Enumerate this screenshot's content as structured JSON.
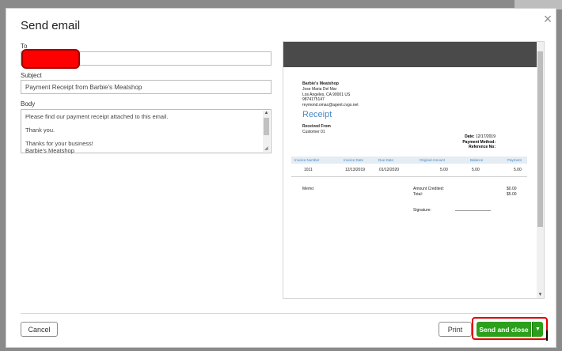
{
  "dialog": {
    "title": "Send email",
    "close_glyph": "×"
  },
  "form": {
    "to_label": "To",
    "to_value": "",
    "subject_label": "Subject",
    "subject_value": "Payment Receipt from Barbie's Meatshop",
    "body_label": "Body",
    "body_lines": [
      "Please find our payment receipt attached to this email.",
      "Thank you.",
      "Thanks for your business!",
      "Barbie's Meatshop"
    ]
  },
  "preview": {
    "business_name": "Barbie's Meatshop",
    "address_lines": [
      "Jose Maria Del Mar",
      "Los Angeles, CA  90001 US",
      "9874175147",
      "reymond.omac@agent.cvgs.net"
    ],
    "doc_title": "Receipt",
    "received_from_label": "Received From",
    "customer": "Customer 01",
    "date_label": "Date:",
    "date_value": "12/17/2019",
    "payment_method_label": "Payment Method:",
    "reference_label": "Reference No:",
    "table_headers": [
      "Invoice Number",
      "Invoice Date",
      "Due Date",
      "Original Amount",
      "Balance",
      "Payment"
    ],
    "table_row": [
      "1011",
      "12/13/2019",
      "01/12/2020",
      "5.00",
      "5.00",
      "5.00"
    ],
    "memo_label": "Memo:",
    "amount_credited_label": "Amount Credited:",
    "amount_credited_value": "$0.00",
    "total_label": "Total:",
    "total_value": "$5.00",
    "signature_label": "Signature:"
  },
  "footer": {
    "cancel_label": "Cancel",
    "print_label": "Print",
    "send_label": "Send and close",
    "send_caret": "▼"
  },
  "colors": {
    "accent_green": "#2ca01c",
    "highlight_red": "#e00000",
    "receipt_blue": "#4a8ac4"
  }
}
